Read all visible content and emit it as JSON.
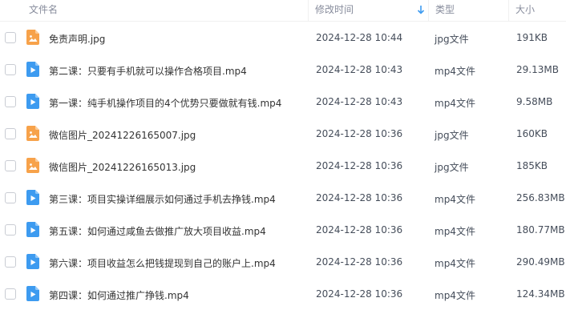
{
  "header": {
    "name": "文件名",
    "modified": "修改时间",
    "type": "类型",
    "size": "大小"
  },
  "colors": {
    "image_icon": "#f7a24a",
    "video_icon": "#3d9bf0",
    "sort_arrow": "#3d9bf0"
  },
  "files": [
    {
      "name": "免责声明.jpg",
      "modified": "2024-12-28 10:44",
      "type": "jpg文件",
      "size": "191KB",
      "icon": "image-file-icon"
    },
    {
      "name": "第二课：只要有手机就可以操作合格项目.mp4",
      "modified": "2024-12-28 10:43",
      "type": "mp4文件",
      "size": "29.13MB",
      "icon": "video-file-icon"
    },
    {
      "name": "第一课：纯手机操作项目的4个优势只要做就有钱.mp4",
      "modified": "2024-12-28 10:43",
      "type": "mp4文件",
      "size": "9.58MB",
      "icon": "video-file-icon"
    },
    {
      "name": "微信图片_20241226165007.jpg",
      "modified": "2024-12-28 10:36",
      "type": "jpg文件",
      "size": "160KB",
      "icon": "image-file-icon"
    },
    {
      "name": "微信图片_20241226165013.jpg",
      "modified": "2024-12-28 10:36",
      "type": "jpg文件",
      "size": "185KB",
      "icon": "image-file-icon"
    },
    {
      "name": "第三课：项目实操详细展示如何通过手机去挣钱.mp4",
      "modified": "2024-12-28 10:36",
      "type": "mp4文件",
      "size": "256.83MB",
      "icon": "video-file-icon"
    },
    {
      "name": "第五课：如何通过咸鱼去做推广放大项目收益.mp4",
      "modified": "2024-12-28 10:36",
      "type": "mp4文件",
      "size": "180.77MB",
      "icon": "video-file-icon"
    },
    {
      "name": "第六课：项目收益怎么把钱提现到自己的账户上.mp4",
      "modified": "2024-12-28 10:36",
      "type": "mp4文件",
      "size": "290.49MB",
      "icon": "video-file-icon"
    },
    {
      "name": "第四课：如何通过推广挣钱.mp4",
      "modified": "2024-12-28 10:36",
      "type": "mp4文件",
      "size": "124.34MB",
      "icon": "video-file-icon"
    }
  ]
}
